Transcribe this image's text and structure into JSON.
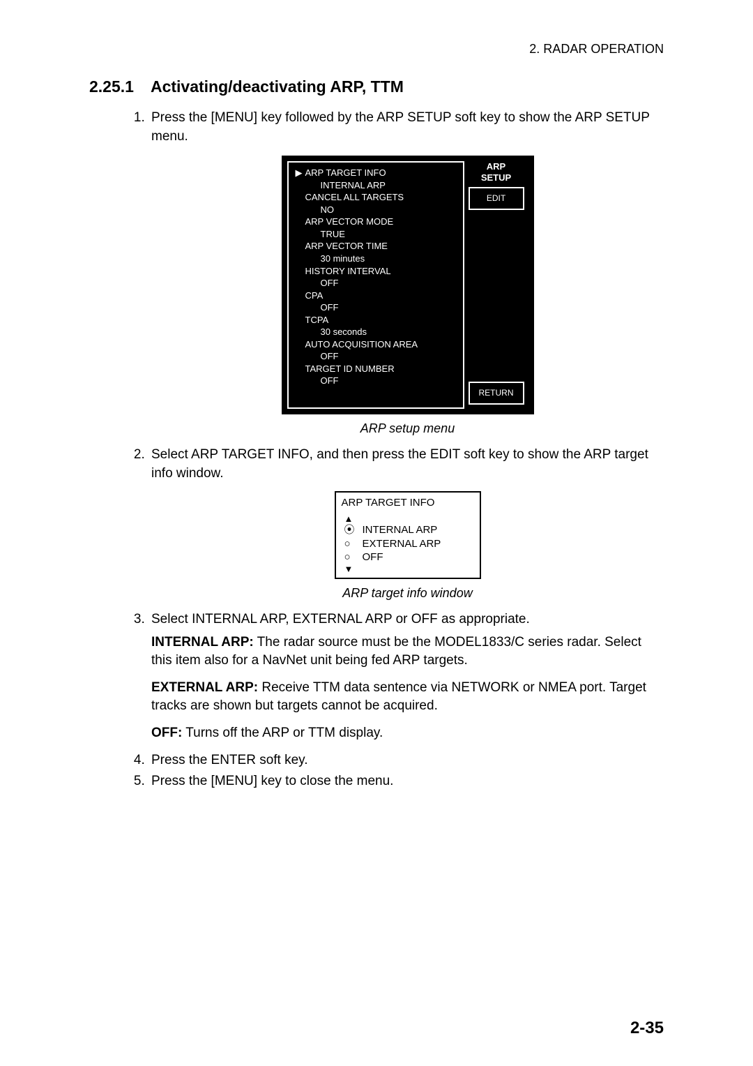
{
  "running_header": "2.  RADAR OPERATION",
  "section": {
    "number": "2.25.1",
    "title": "Activating/deactivating ARP, TTM"
  },
  "steps": {
    "s1": "Press the [MENU] key followed by the ARP SETUP soft key to show the ARP SETUP menu.",
    "s2": "Select ARP TARGET INFO, and then press the EDIT soft key to show the ARP target info window.",
    "s3": "Select INTERNAL ARP, EXTERNAL ARP or OFF as appropriate.",
    "s4": "Press the ENTER soft key.",
    "s5": "Press the [MENU] key to close the menu."
  },
  "arp_setup_menu": {
    "heading_line1": "ARP",
    "heading_line2": "SETUP",
    "edit_btn": "EDIT",
    "return_btn": "RETURN",
    "arrow": "▶",
    "items": [
      {
        "label": "ARP TARGET INFO",
        "value": "INTERNAL ARP"
      },
      {
        "label": "CANCEL ALL TARGETS",
        "value": "NO"
      },
      {
        "label": "ARP VECTOR MODE",
        "value": "TRUE"
      },
      {
        "label": "ARP VECTOR TIME",
        "value": "30 minutes"
      },
      {
        "label": "HISTORY INTERVAL",
        "value": "OFF"
      },
      {
        "label": "CPA",
        "value": "OFF"
      },
      {
        "label": "TCPA",
        "value": "30 seconds"
      },
      {
        "label": "AUTO ACQUISITION AREA",
        "value": "OFF"
      },
      {
        "label": "TARGET ID NUMBER",
        "value": "OFF"
      }
    ]
  },
  "caption1": "ARP setup menu",
  "arp_target_info": {
    "title": "ARP TARGET INFO",
    "up": "▲",
    "down": "▼",
    "options": [
      {
        "mark": "⦿",
        "label": "INTERNAL ARP"
      },
      {
        "mark": "○",
        "label": "EXTERNAL ARP"
      },
      {
        "mark": "○",
        "label": "OFF"
      }
    ]
  },
  "caption2": "ARP target info window",
  "defs": {
    "internal_label": "INTERNAL ARP:",
    "internal_text": " The radar source must be the MODEL1833/C series radar. Select this item also for a NavNet unit being fed ARP targets.",
    "external_label": "EXTERNAL ARP:",
    "external_text": " Receive TTM data sentence via NETWORK or NMEA port. Target tracks are shown but targets cannot be acquired.",
    "off_label": "OFF:",
    "off_text": " Turns off the ARP or TTM display."
  },
  "page_number": "2-35"
}
